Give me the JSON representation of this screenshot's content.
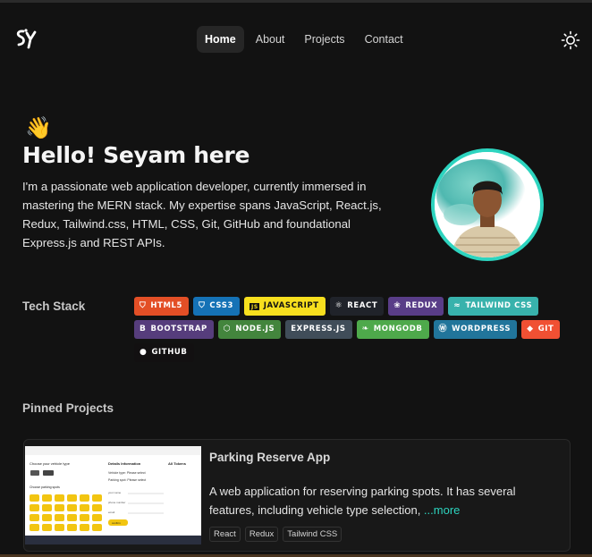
{
  "header": {
    "logo_text": "SY",
    "nav": [
      {
        "label": "Home",
        "active": true
      },
      {
        "label": "About",
        "active": false
      },
      {
        "label": "Projects",
        "active": false
      },
      {
        "label": "Contact",
        "active": false
      }
    ],
    "theme_icon": "sun-icon"
  },
  "hero": {
    "wave_emoji": "👋",
    "title": "Hello! Seyam here",
    "description": "I'm a passionate web application developer, currently immersed in mastering the MERN stack. My expertise spans JavaScript, React.js, Redux, Tailwind.css, HTML, CSS, Git, GitHub and foundational Express.js and REST APIs."
  },
  "tech_stack": {
    "label": "Tech Stack",
    "badges": [
      {
        "label": "HTML5",
        "icon": "html5-icon",
        "color": "#e34f26",
        "text_color": "#ffffff"
      },
      {
        "label": "CSS3",
        "icon": "css3-icon",
        "color": "#1572b6",
        "text_color": "#ffffff"
      },
      {
        "label": "JAVASCRIPT",
        "icon": "javascript-icon",
        "color": "#f7df1e",
        "text_color": "#111111"
      },
      {
        "label": "REACT",
        "icon": "react-icon",
        "color": "#20232a",
        "text_color": "#ffffff"
      },
      {
        "label": "REDUX",
        "icon": "redux-icon",
        "color": "#593d88",
        "text_color": "#ffffff"
      },
      {
        "label": "TAILWIND CSS",
        "icon": "tailwind-icon",
        "color": "#38b2ac",
        "text_color": "#ffffff"
      },
      {
        "label": "BOOTSTRAP",
        "icon": "bootstrap-icon",
        "color": "#563d7c",
        "text_color": "#ffffff"
      },
      {
        "label": "NODE.JS",
        "icon": "nodejs-icon",
        "color": "#43853d",
        "text_color": "#ffffff"
      },
      {
        "label": "EXPRESS.JS",
        "icon": "",
        "color": "#404d59",
        "text_color": "#ffffff"
      },
      {
        "label": "MONGODB",
        "icon": "mongodb-icon",
        "color": "#4ea94b",
        "text_color": "#ffffff"
      },
      {
        "label": "WORDPRESS",
        "icon": "wordpress-icon",
        "color": "#21759b",
        "text_color": "#ffffff"
      },
      {
        "label": "GIT",
        "icon": "git-icon",
        "color": "#f05033",
        "text_color": "#ffffff"
      },
      {
        "label": "GITHUB",
        "icon": "github-icon",
        "color": "#121011",
        "text_color": "#ffffff"
      }
    ]
  },
  "pinned": {
    "label": "Pinned Projects",
    "projects": [
      {
        "title": "Parking Reserve App",
        "description": "A web application for reserving parking spots. It has several features, including vehicle type selection, ",
        "more_label": "...more",
        "tags": [
          "React",
          "Redux",
          "Tailwind CSS"
        ],
        "thumb": {
          "heading_left": "Choose your vehicle type",
          "heading_mid": "Details Information",
          "heading_right": "All Tokens",
          "vehicle_line": "Vehicle type: Please select",
          "parking_line": "Parking spot: Please select",
          "choose_spot": "Choose parking spots",
          "fields": [
            "your name",
            "phone number",
            "email"
          ],
          "button": "confirm"
        }
      }
    ]
  }
}
